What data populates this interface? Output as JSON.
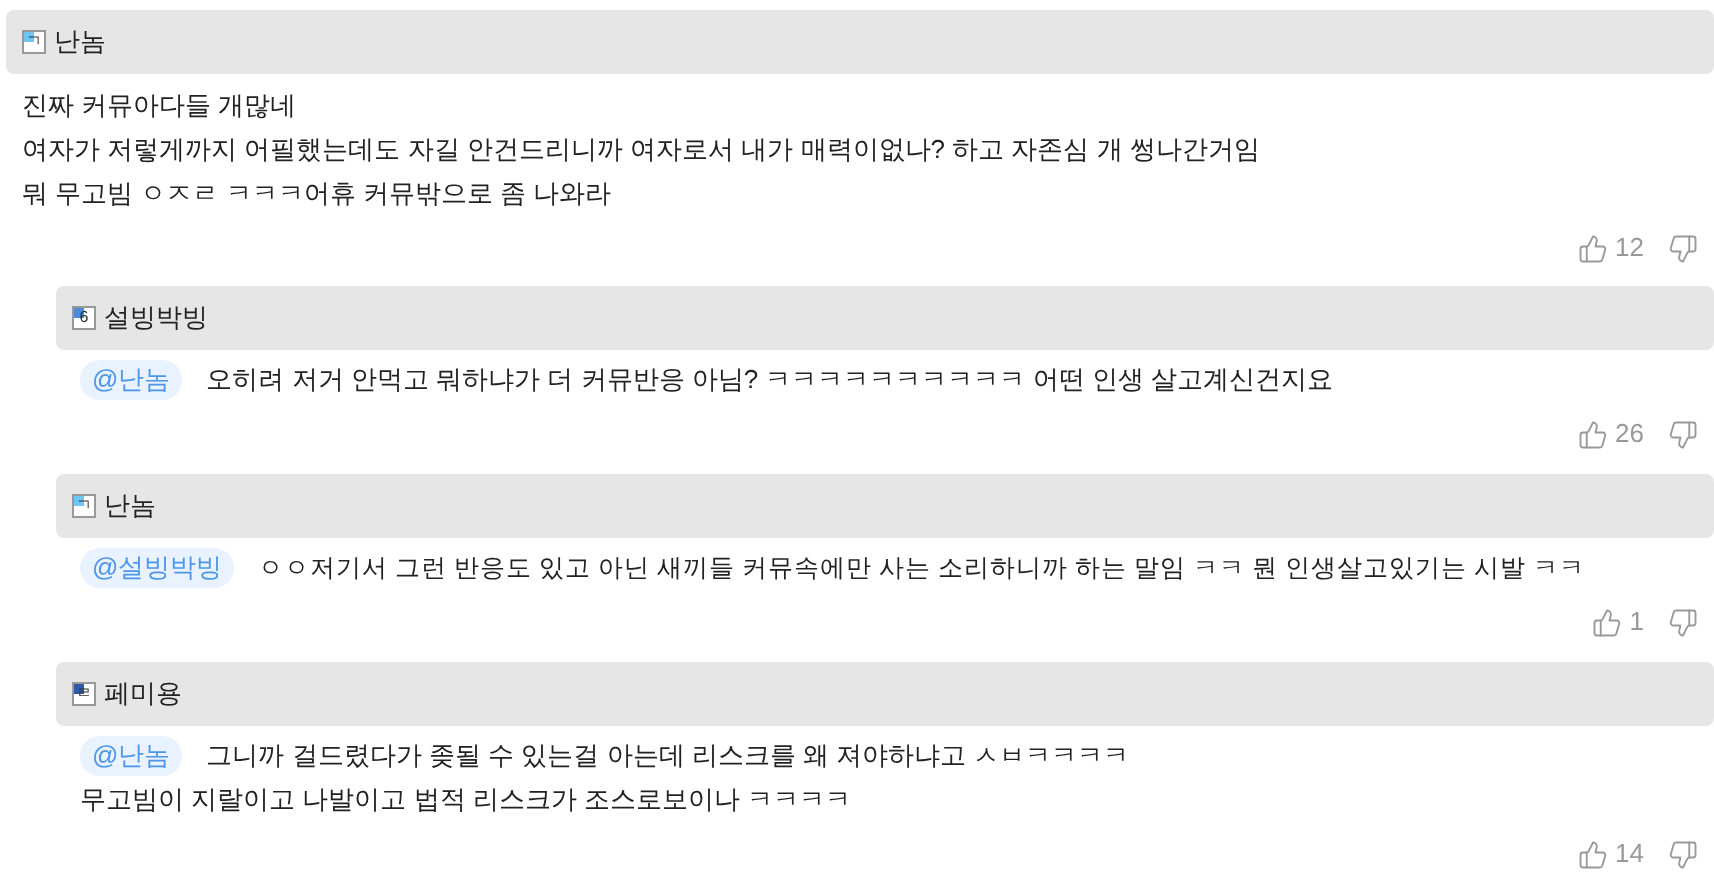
{
  "comments": [
    {
      "author": "난놈",
      "badge": "ㄱ",
      "color": "#6ec6f5",
      "lines": [
        "진짜 커뮤아다들 개많네",
        "여자가 저렇게까지 어필했는데도 자길 안건드리니까 여자로서 내가 매력이없나? 하고 자존심 개 썽나간거임",
        "뭐 무고빔 ㅇㅈㄹ ㅋㅋㅋ어휴 커뮤밖으로 좀 나와라"
      ],
      "likes": "12",
      "children": [
        {
          "author": "설빙박빙",
          "badge": "6",
          "color": "#4a8be0",
          "mention": "@난놈",
          "lines": [
            "오히려 저거 안먹고 뭐하냐가 더 커뮤반응 아님? ㅋㅋㅋㅋㅋㅋㅋㅋㅋㅋ 어떤 인생 살고계신건지요"
          ],
          "likes": "26"
        },
        {
          "author": "난놈",
          "badge": "ㄱ",
          "color": "#6ec6f5",
          "mention": "@설빙박빙",
          "lines": [
            "ㅇㅇ저기서 그런 반응도 있고 아닌 새끼들 커뮤속에만 사는 소리하니까 하는 말임 ㅋㅋ 뭔 인생살고있기는 시발 ㅋㅋ"
          ],
          "likes": "1"
        },
        {
          "author": "페미용",
          "badge": "ㄹ",
          "color": "#2f5aa8",
          "mention": "@난놈",
          "lines": [
            "그니까 걸드렸다가 좆될 수 있는걸 아는데 리스크를 왜 져야하냐고 ㅅㅂㅋㅋㅋㅋ",
            "무고빔이 지랄이고 나발이고 법적 리스크가 조스로보이나 ㅋㅋㅋㅋ"
          ],
          "likes": "14"
        }
      ]
    }
  ]
}
